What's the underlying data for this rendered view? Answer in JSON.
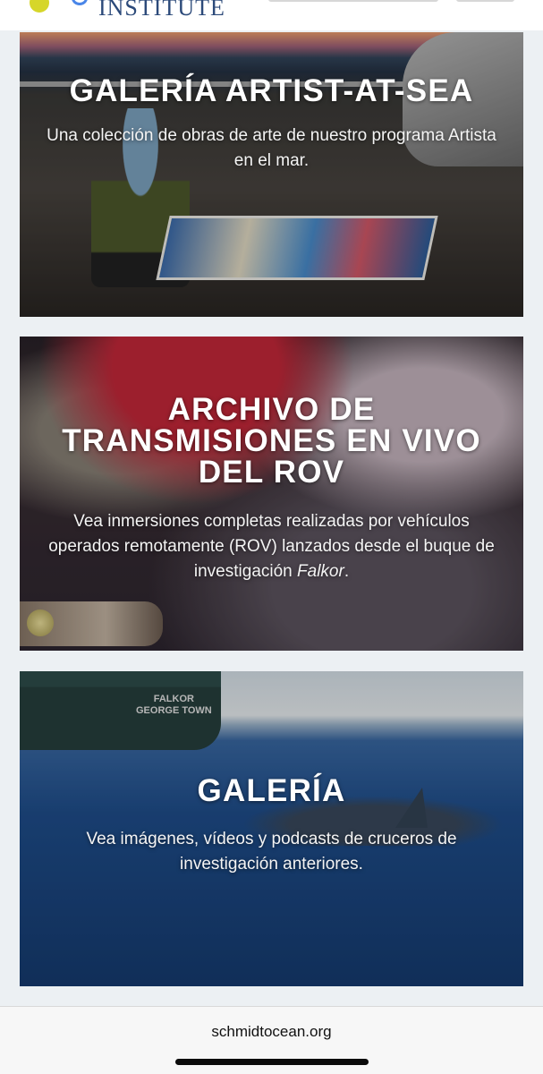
{
  "header": {
    "logo_text": "INSTITUTE"
  },
  "cards": [
    {
      "title": "GALERÍA ARTIST-AT-SEA",
      "description": "Una colección de obras de arte de nuestro programa Artista en el mar."
    },
    {
      "title": "ARCHIVO DE TRANSMISIONES EN VIVO DEL ROV",
      "description_prefix": "Vea inmersiones completas realizadas por vehículos operados remotamente (ROV) lanzados desde el buque de investigación ",
      "description_italic": "Falkor",
      "description_suffix": "."
    },
    {
      "title": "GALERÍA",
      "description": "Vea imágenes, vídeos y podcasts de cruceros de investigación anteriores.",
      "ship_label_line1": "FALKOR",
      "ship_label_line2": "GEORGE TOWN"
    }
  ],
  "browser": {
    "url": "schmidtocean.org"
  },
  "colors": {
    "page_background": "#ecf0f3",
    "logo_accent": "#d6d62a",
    "logo_text": "#2c4a7a"
  }
}
